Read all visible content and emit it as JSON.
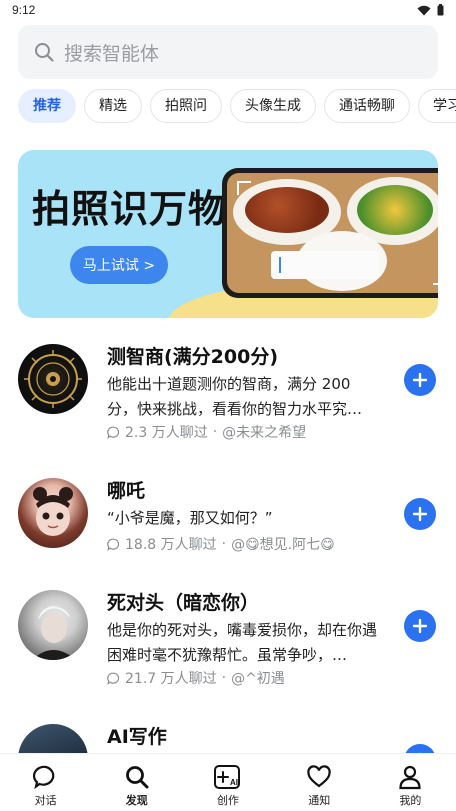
{
  "status_bar": {
    "time": "9:12"
  },
  "search": {
    "placeholder": "搜索智能体"
  },
  "tabs": [
    {
      "label": "推荐",
      "active": true
    },
    {
      "label": "精选",
      "active": false
    },
    {
      "label": "拍照问",
      "active": false
    },
    {
      "label": "头像生成",
      "active": false
    },
    {
      "label": "通话畅聊",
      "active": false
    },
    {
      "label": "学习",
      "active": false
    }
  ],
  "banner": {
    "title": "拍照识万物",
    "button_label": "马上试试 >"
  },
  "agents": [
    {
      "title": "测智商(满分200分)",
      "description": "他能出十道题测你的智商，满分 200 分，快来挑战，看看你的智力水平究…",
      "chats": "2.3 万人聊过",
      "author": "@未来之希望"
    },
    {
      "title": "哪吒",
      "description": "“小爷是魔，那又如何？”",
      "chats": "18.8 万人聊过",
      "author": "@😋想见.阿七😋"
    },
    {
      "title": "死对头（暗恋你）",
      "description": "他是你的死对头，嘴毒爱损你，却在你遇困难时毫不犹豫帮忙。虽常争吵，…",
      "chats": "21.7 万人聊过",
      "author": "@^初遇"
    },
    {
      "title": "AI写作",
      "description": "",
      "chats": "",
      "author": ""
    }
  ],
  "bottom_nav": [
    {
      "label": "对话",
      "icon": "chat-bubble-icon"
    },
    {
      "label": "发现",
      "icon": "search-icon"
    },
    {
      "label": "创作",
      "icon": "create-ai-icon"
    },
    {
      "label": "通知",
      "icon": "heart-icon"
    },
    {
      "label": "我的",
      "icon": "person-icon"
    }
  ],
  "colors": {
    "accent": "#2a72f0",
    "banner_bg": "#a9e3f7",
    "tab_active_bg": "#e6efff"
  }
}
